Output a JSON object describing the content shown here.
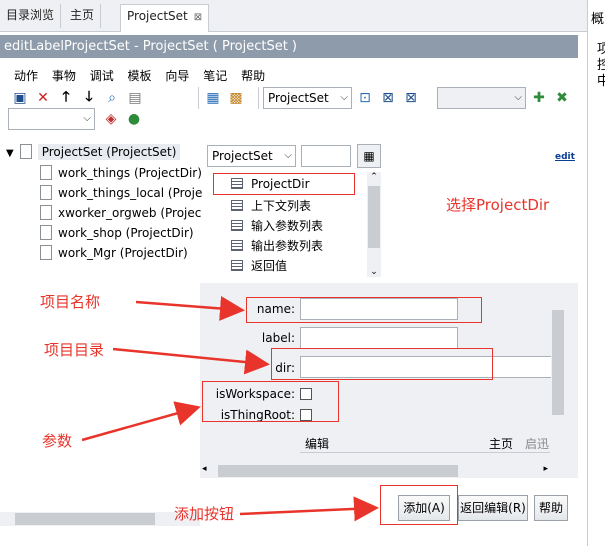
{
  "tabs": [
    {
      "label": "目录浏览"
    },
    {
      "label": "主页"
    },
    {
      "label": "ProjectSet",
      "close": "⊠"
    }
  ],
  "right_panel": {
    "title": "概",
    "chars": [
      "项",
      "控",
      "中"
    ]
  },
  "window_title": "editLabelProjectSet - ProjectSet ( ProjectSet )",
  "menu": [
    "动作",
    "事物",
    "调试",
    "模板",
    "向导",
    "笔记",
    "帮助"
  ],
  "toolbar": {
    "type_combo_value": "ProjectSet",
    "empty_combo_value": "",
    "small_combo_value": ""
  },
  "tree": {
    "root": "ProjectSet (ProjectSet)",
    "items": [
      "work_things (ProjectDir)",
      "work_things_local (Proje",
      "xworker_orgweb (Projec",
      "work_shop (ProjectDir)",
      "work_Mgr (ProjectDir)"
    ]
  },
  "middle": {
    "combo_value": "ProjectSet",
    "list": [
      "ProjectDir",
      "上下文列表",
      "输入参数列表",
      "输出参数列表",
      "返回值"
    ],
    "edit_link": "edit"
  },
  "form": {
    "name_label": "name:",
    "label_label": "label:",
    "dir_label": "dir:",
    "isworkspace_label": "isWorkspace:",
    "isthingroot_label": "isThingRoot:",
    "name_value": "",
    "label_value": "",
    "dir_value": "",
    "partial_row": {
      "left": "编辑",
      "right": "主页",
      "far_right": "启迅"
    }
  },
  "buttons": {
    "add": "添加(A)",
    "back": "返回编辑(R)",
    "help": "帮助"
  },
  "annotations": {
    "select_projectdir": "选择ProjectDir",
    "project_name": "项目名称",
    "project_dir": "项目目录",
    "params": "参数",
    "add_button": "添加按钮"
  },
  "colors": {
    "annotation": "#e8342b",
    "title_bar": "#8e9bab",
    "panel_bg": "#eef0f3"
  }
}
